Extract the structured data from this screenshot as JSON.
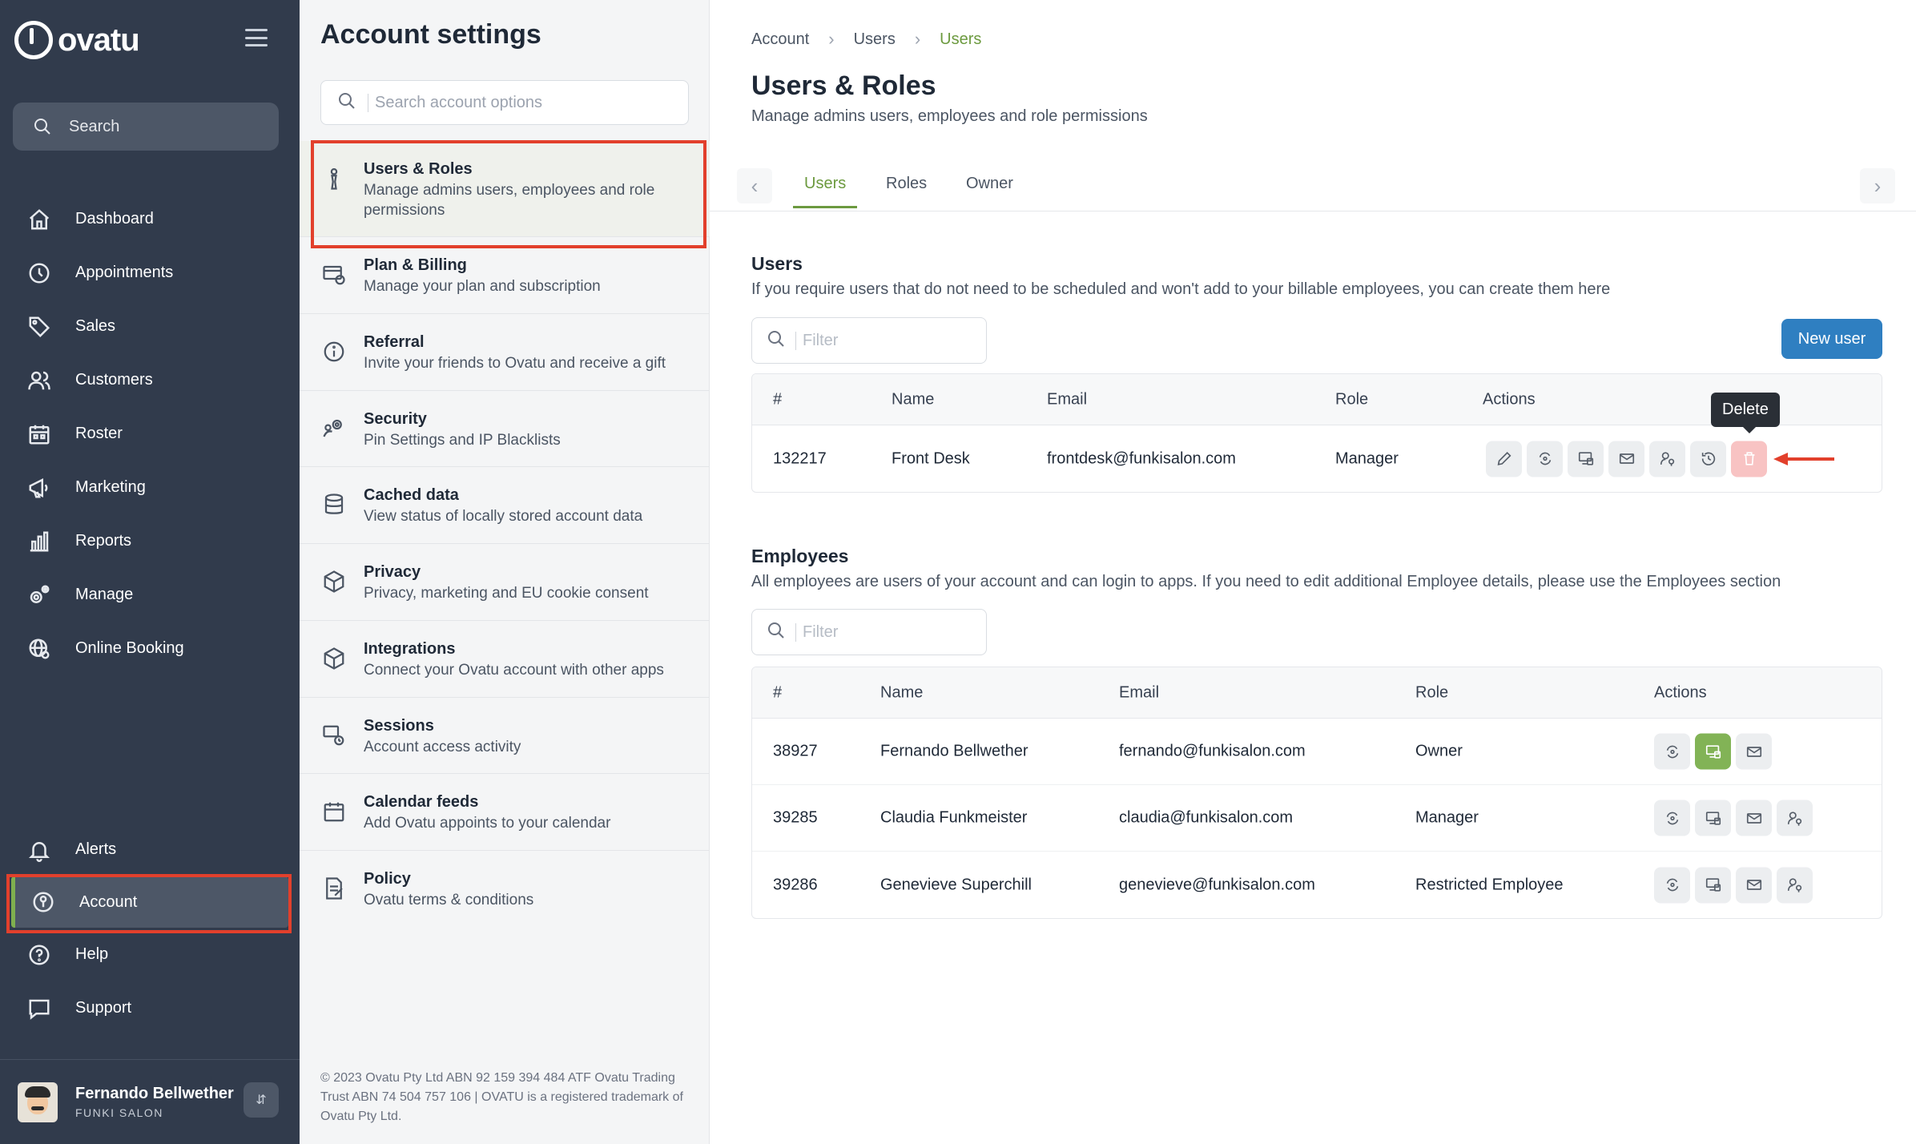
{
  "app": {
    "logo_text": "ovatu"
  },
  "sidebar": {
    "search_label": "Search",
    "items": [
      {
        "label": "Dashboard",
        "icon": "home-icon"
      },
      {
        "label": "Appointments",
        "icon": "clock-icon"
      },
      {
        "label": "Sales",
        "icon": "tag-icon"
      },
      {
        "label": "Customers",
        "icon": "users-icon"
      },
      {
        "label": "Roster",
        "icon": "calendar-icon"
      },
      {
        "label": "Marketing",
        "icon": "megaphone-icon"
      },
      {
        "label": "Reports",
        "icon": "bar-chart-icon"
      },
      {
        "label": "Manage",
        "icon": "gears-icon"
      },
      {
        "label": "Online Booking",
        "icon": "globe-gear-icon"
      }
    ],
    "bottom_items": [
      {
        "label": "Alerts",
        "icon": "bell-icon"
      },
      {
        "label": "Account",
        "icon": "account-icon"
      },
      {
        "label": "Help",
        "icon": "help-icon"
      },
      {
        "label": "Support",
        "icon": "chat-icon"
      }
    ],
    "profile": {
      "name": "Fernando Bellwether",
      "org": "FUNKI SALON"
    },
    "accent_color": "#7fb04f"
  },
  "settings": {
    "title": "Account settings",
    "search_placeholder": "Search account options",
    "options": [
      {
        "title": "Users & Roles",
        "desc": "Manage admins users, employees and role permissions"
      },
      {
        "title": "Plan & Billing",
        "desc": "Manage your plan and subscription"
      },
      {
        "title": "Referral",
        "desc": "Invite your friends to Ovatu and receive a gift"
      },
      {
        "title": "Security",
        "desc": "Pin Settings and IP Blacklists"
      },
      {
        "title": "Cached data",
        "desc": "View status of locally stored account data"
      },
      {
        "title": "Privacy",
        "desc": "Privacy, marketing and EU cookie consent"
      },
      {
        "title": "Integrations",
        "desc": "Connect your Ovatu account with other apps"
      },
      {
        "title": "Sessions",
        "desc": "Account access activity"
      },
      {
        "title": "Calendar feeds",
        "desc": "Add Ovatu appoints to your calendar"
      },
      {
        "title": "Policy",
        "desc": "Ovatu terms & conditions"
      }
    ],
    "footer": "© 2023 Ovatu Pty Ltd ABN 92 159 394 484 ATF Ovatu Trading Trust ABN 74 504 757 106 | OVATU is a registered trademark of Ovatu Pty Ltd."
  },
  "main": {
    "breadcrumbs": [
      "Account",
      "Users",
      "Users"
    ],
    "title": "Users & Roles",
    "subtitle": "Manage admins users, employees and role permissions",
    "tabs": [
      "Users",
      "Roles",
      "Owner"
    ],
    "users": {
      "title": "Users",
      "desc": "If you require users that do not need to be scheduled and won't add to your billable employees, you can create them here",
      "filter_placeholder": "Filter",
      "new_button": "New user",
      "columns": [
        "#",
        "Name",
        "Email",
        "Role",
        "Actions"
      ],
      "rows": [
        {
          "id": "132217",
          "name": "Front Desk",
          "email": "frontdesk@funkisalon.com",
          "role": "Manager"
        }
      ],
      "tooltip": "Delete"
    },
    "employees": {
      "title": "Employees",
      "desc": "All employees are users of your account and can login to apps. If you need to edit additional Employee details, please use the Employees section",
      "filter_placeholder": "Filter",
      "columns": [
        "#",
        "Name",
        "Email",
        "Role",
        "Actions"
      ],
      "rows": [
        {
          "id": "38927",
          "name": "Fernando Bellwether",
          "email": "fernando@funkisalon.com",
          "role": "Owner"
        },
        {
          "id": "39285",
          "name": "Claudia Funkmeister",
          "email": "claudia@funkisalon.com",
          "role": "Manager"
        },
        {
          "id": "39286",
          "name": "Genevieve Superchill",
          "email": "genevieve@funkisalon.com",
          "role": "Restricted Employee"
        }
      ]
    },
    "colors": {
      "primary": "#2f7fc1",
      "accent": "#6c9a3f",
      "danger_highlight": "#e2402c"
    }
  }
}
